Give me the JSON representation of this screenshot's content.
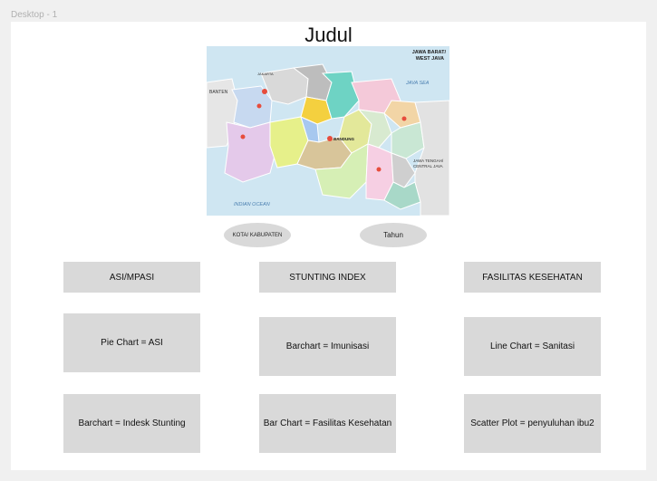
{
  "frame": {
    "label": "Desktop - 1"
  },
  "page": {
    "title": "Judul"
  },
  "map": {
    "title_lines": [
      "JAWA BARAT/",
      "WEST JAVA"
    ],
    "sea_label": "JAVA SEA",
    "ocean_label": "INDIAN OCEAN",
    "banten_label": "BANTEN",
    "jakarta_label": "JAKARTA",
    "central_java_lines": [
      "JAWA TENGAH/",
      "CENTRAL JAVA"
    ],
    "bandung_label": "BANDUNG"
  },
  "filters": {
    "kota_label": "KOTA/ KABUPATEN",
    "tahun_label": "Tahun"
  },
  "categories": [
    "ASI/MPASI",
    "STUNTING INDEX",
    "FASILITAS KESEHATAN"
  ],
  "charts": [
    [
      "Pie Chart = ASI",
      "Barchart = Imunisasi",
      "Line Chart = Sanitasi"
    ],
    [
      "Barchart = Indesk Stunting",
      "Bar Chart = Fasilitas Kesehatan",
      "Scatter Plot = penyuluhan ibu2"
    ]
  ],
  "colors": {
    "background": "#f0f0f0",
    "canvas": "#ffffff",
    "box": "#d9d9d9",
    "sea": "#cfe6f2"
  }
}
